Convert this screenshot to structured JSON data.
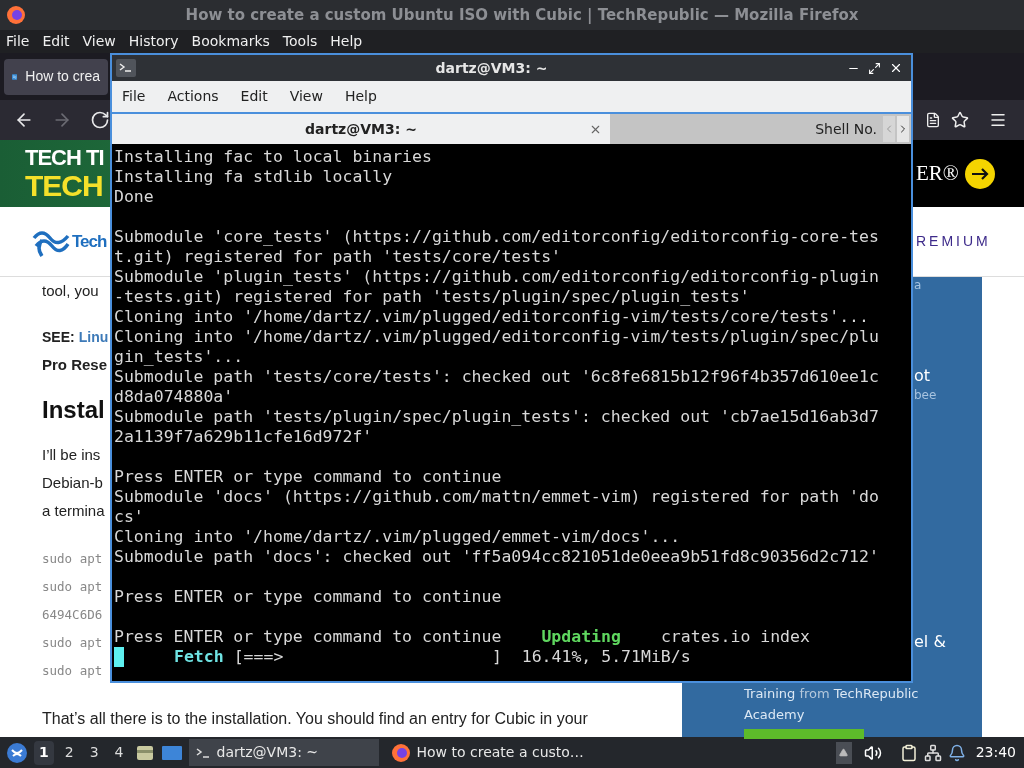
{
  "browser": {
    "title": "How to create a custom Ubuntu ISO with Cubic | TechRepublic — Mozilla Firefox",
    "menu": [
      "File",
      "Edit",
      "View",
      "History",
      "Bookmarks",
      "Tools",
      "Help"
    ],
    "tab": {
      "label": "How to crea",
      "selected": true
    },
    "nav": [
      {
        "kind": "back",
        "disabled": false
      },
      {
        "kind": "forward",
        "disabled": true
      },
      {
        "kind": "reload",
        "disabled": false
      }
    ],
    "banner": {
      "line_1": "TECH TI",
      "line_2": "TECH",
      "right_text": "ER®"
    },
    "header": {
      "logo": "Tech",
      "premium": "REMIUM"
    },
    "article": [
      {
        "kind": "para",
        "text": "tool, you"
      },
      {
        "kind": "see",
        "label": "SEE:",
        "link": "Linu"
      },
      {
        "kind": "bold",
        "text": "Pro Rese"
      },
      {
        "kind": "heading",
        "text": "Instal"
      },
      {
        "kind": "para",
        "text": "I’ll be ins"
      },
      {
        "kind": "para",
        "text": "Debian-b"
      },
      {
        "kind": "para",
        "text": "a termina"
      },
      {
        "kind": "code",
        "text": "sudo apt"
      },
      {
        "kind": "code",
        "text": "sudo apt"
      },
      {
        "kind": "code",
        "text": "6494C6D6"
      },
      {
        "kind": "code",
        "text": "sudo apt"
      },
      {
        "kind": "code",
        "text": "sudo apt"
      },
      {
        "kind": "para",
        "text": "That’s all there is to the installation. You should find an entry for Cubic in your"
      }
    ],
    "sidebar": {
      "fragments": [
        "a",
        "ot",
        "bee",
        "el &"
      ],
      "promo": [
        "Training",
        "from",
        "TechRepublic"
      ],
      "promo_2": "Academy"
    }
  },
  "terminal": {
    "title": "dartz@VM3: ~",
    "menu": [
      "File",
      "Actions",
      "Edit",
      "View",
      "Help"
    ],
    "tabs": [
      {
        "label": "dartz@VM3: ~",
        "selected": true
      },
      {
        "label": "Shell No.",
        "selected": false
      }
    ],
    "blocks": [
      [
        "Installing fac to local binaries",
        "Installing fa stdlib locally",
        "Done"
      ],
      [
        "Submodule 'core_tests' (https://github.com/editorconfig/editorconfig-core-tes",
        "t.git) registered for path 'tests/core/tests'",
        "Submodule 'plugin_tests' (https://github.com/editorconfig/editorconfig-plugin",
        "-tests.git) registered for path 'tests/plugin/spec/plugin_tests'",
        "Cloning into '/home/dartz/.vim/plugged/editorconfig-vim/tests/core/tests'...",
        "Cloning into '/home/dartz/.vim/plugged/editorconfig-vim/tests/plugin/spec/plu",
        "gin_tests'...",
        "Submodule path 'tests/core/tests': checked out '6c8fe6815b12f96f4b357d610ee1c",
        "d8da074880a'",
        "Submodule path 'tests/plugin/spec/plugin_tests': checked out 'cb7ae15d16ab3d7",
        "2a1139f7a629b11cfe16d972f'"
      ],
      [
        "Press ENTER or type command to continue",
        "Submodule 'docs' (https://github.com/mattn/emmet-vim) registered for path 'do",
        "cs'",
        "Cloning into '/home/dartz/.vim/plugged/emmet-vim/docs'...",
        "Submodule path 'docs': checked out 'ff5a094cc821051de0eea9b51fd8c90356d2c712'"
      ],
      [
        "Press ENTER or type command to continue"
      ]
    ],
    "status_lines": [
      {
        "cursor": false,
        "segments": [
          {
            "kind": "plain",
            "text": "Press ENTER or type command to continue"
          },
          {
            "kind": "green",
            "text": "Updating"
          },
          {
            "kind": "plain",
            "text": "crates.io index"
          }
        ]
      },
      {
        "cursor": true,
        "segments": [
          {
            "kind": "cyan",
            "text": "Fetch"
          },
          {
            "kind": "plain",
            "text": "[===>                     ]  16.41%, 5.71MiB/s"
          }
        ]
      }
    ]
  },
  "taskbar": {
    "workspaces": [
      {
        "label": "1",
        "selected": true
      },
      {
        "label": "2",
        "selected": false
      },
      {
        "label": "3",
        "selected": false
      },
      {
        "label": "4",
        "selected": false
      }
    ],
    "tasks": [
      {
        "kind": "terminal",
        "label": "dartz@VM3: ~",
        "selected": true
      },
      {
        "kind": "firefox",
        "label": "How to create a custo…",
        "selected": false
      }
    ],
    "clock": "23:40"
  }
}
